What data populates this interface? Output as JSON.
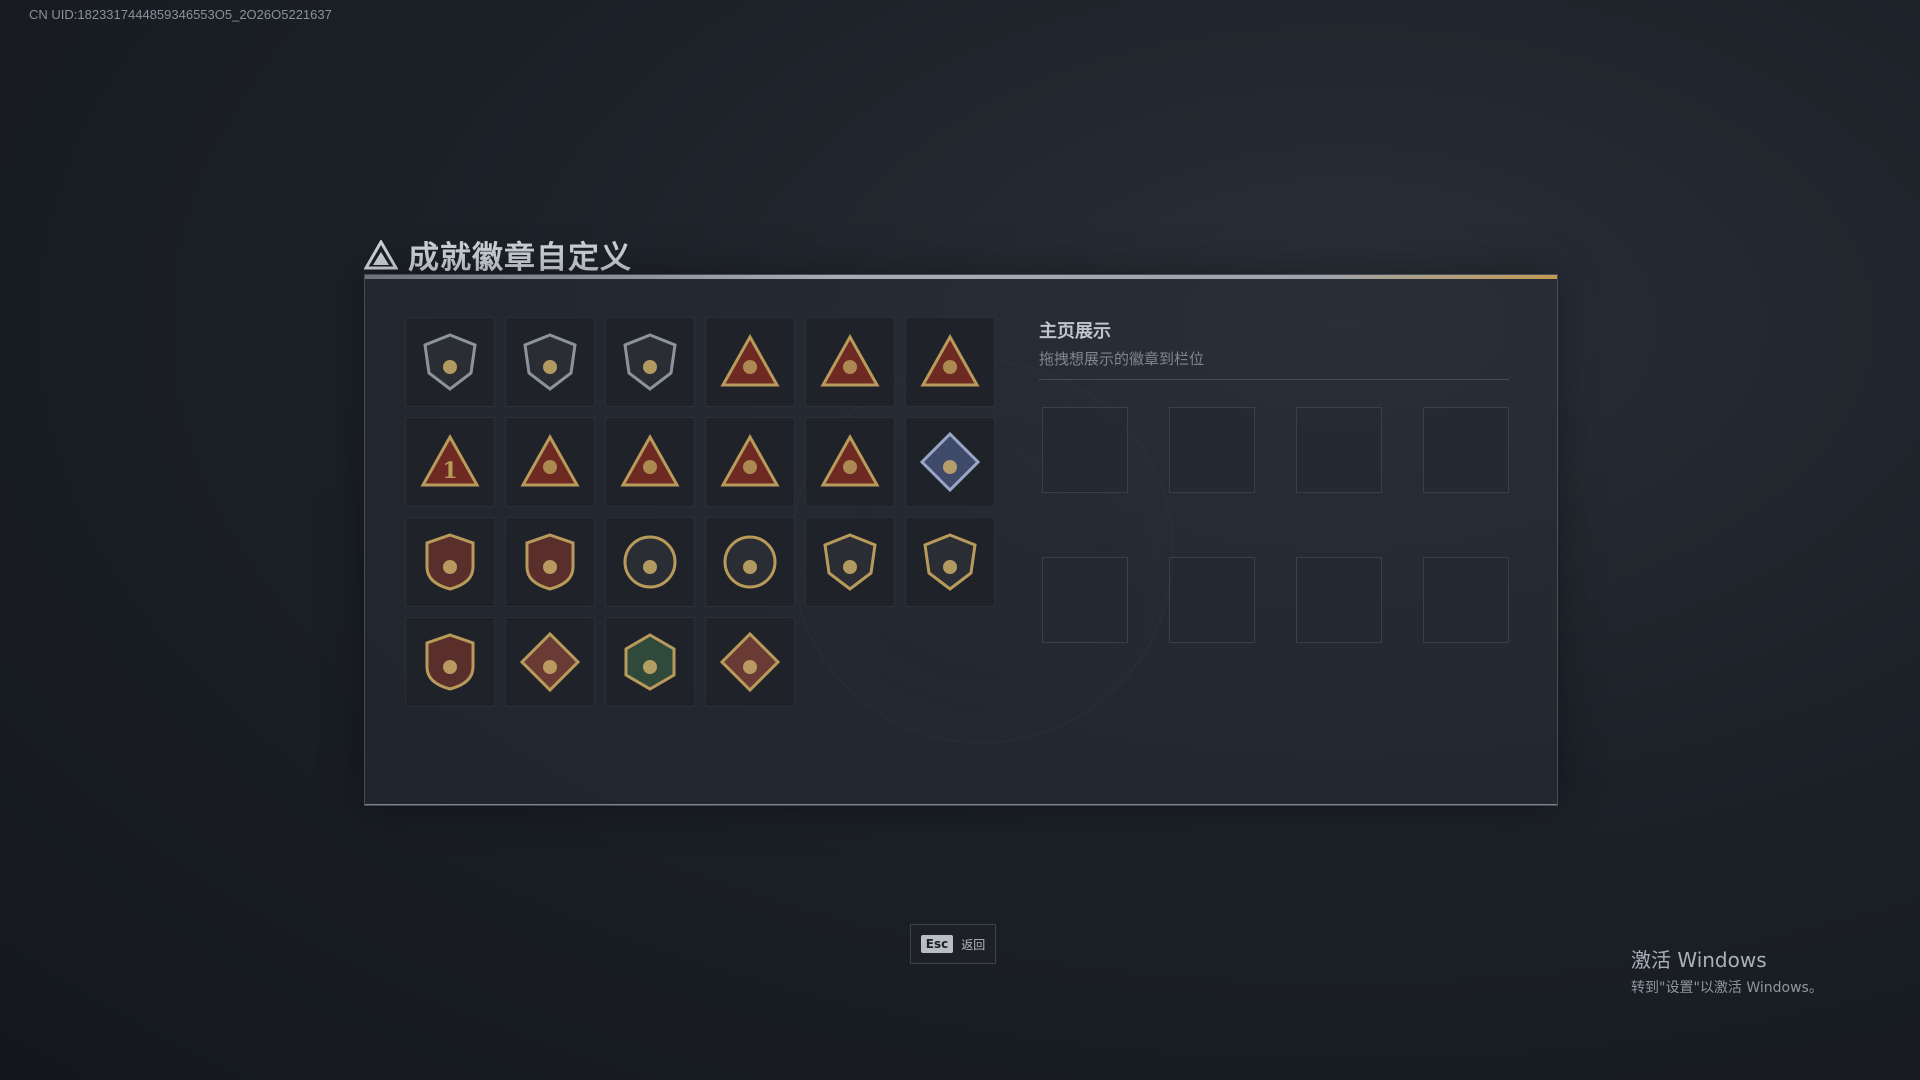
{
  "uid_text": "CN UID:1823317444859346553O5_2O26O5221637",
  "title": "成就徽章自定义",
  "showcase": {
    "title": "主页展示",
    "hint": "拖拽想展示的徽章到栏位",
    "slots": 8
  },
  "badges": [
    {
      "name": "shield-triangle-badge"
    },
    {
      "name": "shield-helicopter-badge"
    },
    {
      "name": "shield-jet-badge"
    },
    {
      "name": "triangle-tank-badge"
    },
    {
      "name": "triangle-hand-badge"
    },
    {
      "name": "triangle-leaf-badge"
    },
    {
      "name": "triangle-number-one-badge",
      "label": "1"
    },
    {
      "name": "triangle-crate-badge"
    },
    {
      "name": "triangle-soldier-badge"
    },
    {
      "name": "triangle-soldier-group-badge"
    },
    {
      "name": "triangle-missile-badge"
    },
    {
      "name": "diamond-cube-badge"
    },
    {
      "name": "star-skull-medal-badge"
    },
    {
      "name": "crest-stars-badge"
    },
    {
      "name": "round-skull-badge"
    },
    {
      "name": "round-gear-badge"
    },
    {
      "name": "shield-no-gun-badge"
    },
    {
      "name": "shield-no-rifle-badge"
    },
    {
      "name": "crest-crossed-badge"
    },
    {
      "name": "diamond-wolf-badge"
    },
    {
      "name": "hexagon-bee-badge"
    },
    {
      "name": "diamond-dragon-badge"
    }
  ],
  "footer": {
    "esc_key": "Esc",
    "esc_label": "返回"
  },
  "windows_activation": {
    "title": "激活 Windows",
    "subtitle": "转到\"设置\"以激活 Windows。"
  }
}
